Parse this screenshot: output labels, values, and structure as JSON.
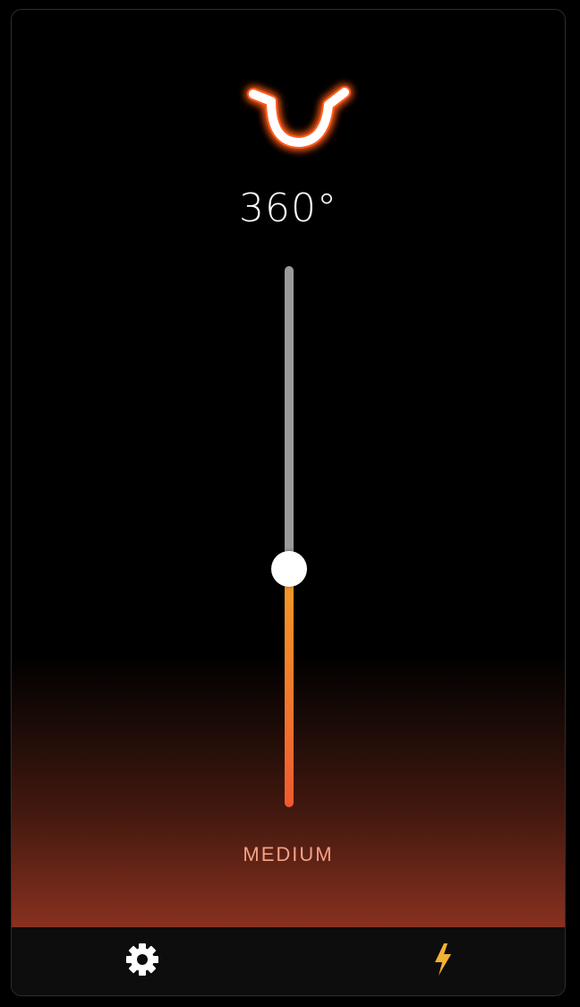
{
  "app": {
    "accent_color": "#f39a26",
    "accent_color_end": "#ee5a30",
    "logo_icon": "bull-horns-icon"
  },
  "display": {
    "temperature": "360°"
  },
  "slider": {
    "level_fraction": 0.44,
    "level_label": "MEDIUM"
  },
  "bottom_bar": {
    "settings_icon": "gear-icon",
    "power_icon": "lightning-bolt-icon",
    "power_icon_color": "#f2b233"
  }
}
